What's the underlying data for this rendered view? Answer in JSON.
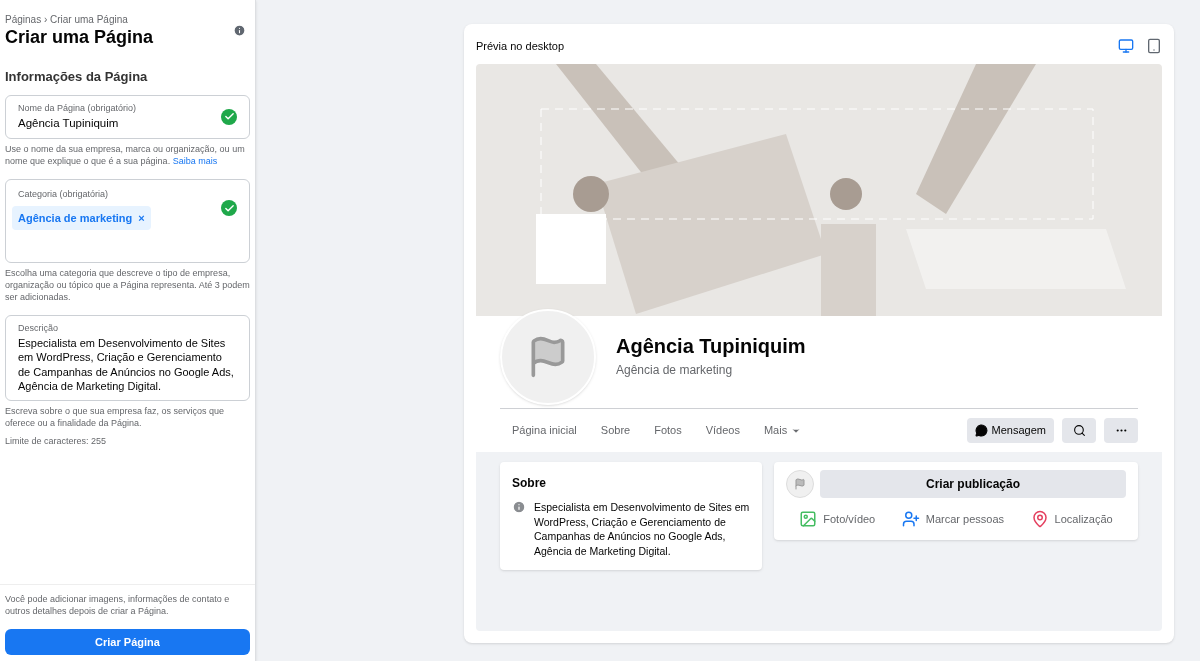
{
  "sidebar": {
    "breadcrumb": "Páginas › Criar uma Página",
    "title": "Criar uma Página",
    "section_title": "Informações da Página",
    "name_field": {
      "label": "Nome da Página (obrigatório)",
      "value": "Agência Tupiniquim",
      "valid": true
    },
    "name_help": "Use o nome da sua empresa, marca ou organização, ou um nome que explique o que é a sua página.",
    "name_help_link": "Saiba mais",
    "category_field": {
      "label": "Categoria (obrigatória)",
      "valid": true,
      "chips": [
        {
          "label": "Agência de marketing",
          "remove": "×"
        }
      ]
    },
    "category_help": "Escolha uma categoria que descreve o tipo de empresa, organização ou tópico que a Página representa. Até 3 podem ser adicionadas.",
    "description_field": {
      "label": "Descrição",
      "value": "Especialista em Desenvolvimento de Sites em WordPress, Criação e Gerenciamento de Campanhas de Anúncios no Google Ads, Agência de Marketing Digital."
    },
    "description_help": "Escreva sobre o que sua empresa faz, os serviços que oferece ou a finalidade da Página.",
    "char_limit": "Limite de caracteres: 255",
    "footer_note": "Você pode adicionar imagens, informações de contato e outros detalhes depois de criar a Página.",
    "create_button": "Criar Página"
  },
  "preview": {
    "title": "Prévia no desktop",
    "devices": [
      {
        "kind": "desktop",
        "selected": true
      },
      {
        "kind": "mobile",
        "selected": false
      }
    ],
    "page_name": "Agência Tupiniquim",
    "page_category": "Agência de marketing",
    "tabs": [
      {
        "label": "Página inicial",
        "dropdown": false
      },
      {
        "label": "Sobre",
        "dropdown": false
      },
      {
        "label": "Fotos",
        "dropdown": false
      },
      {
        "label": "Vídeos",
        "dropdown": false
      },
      {
        "label": "Mais",
        "dropdown": true
      }
    ],
    "message_button": "Mensagem",
    "about": {
      "title": "Sobre",
      "text": "Especialista em Desenvolvimento de Sites em WordPress, Criação e Gerenciamento de Campanhas de Anúncios no Google Ads, Agência de Marketing Digital."
    },
    "composer": {
      "button": "Criar publicação",
      "actions": [
        {
          "kind": "photo",
          "label": "Foto/vídeo"
        },
        {
          "kind": "tag",
          "label": "Marcar pessoas"
        },
        {
          "kind": "location",
          "label": "Localização"
        }
      ]
    }
  }
}
